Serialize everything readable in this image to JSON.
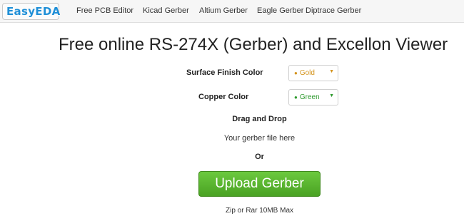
{
  "navbar": {
    "logo_text": "EasyEDA",
    "items": [
      {
        "label": "Free PCB Editor"
      },
      {
        "label": "Kicad Gerber"
      },
      {
        "label": "Altium Gerber"
      },
      {
        "label": "Eagle Gerber"
      },
      {
        "label": "Diptrace Gerber"
      }
    ]
  },
  "main": {
    "title": "Free online RS-274X (Gerber) and Excellon Viewer",
    "surface_finish": {
      "label": "Surface Finish Color",
      "value": "Gold",
      "color": "#d4941d"
    },
    "copper": {
      "label": "Copper Color",
      "value": "Green",
      "color": "#2e9a2e"
    },
    "drag_title": "Drag and Drop",
    "drag_sub": "Your gerber file here",
    "or_text": "Or",
    "upload_label": "Upload Gerber",
    "hint": "Zip or Rar 10MB Max"
  },
  "icons": {
    "logo": "easyeda-logo-icon",
    "dot": "color-dot-icon",
    "caret": "caret-down-icon"
  },
  "colors": {
    "brand": "#1f8fd7",
    "upload_button": "#5bb62f"
  }
}
